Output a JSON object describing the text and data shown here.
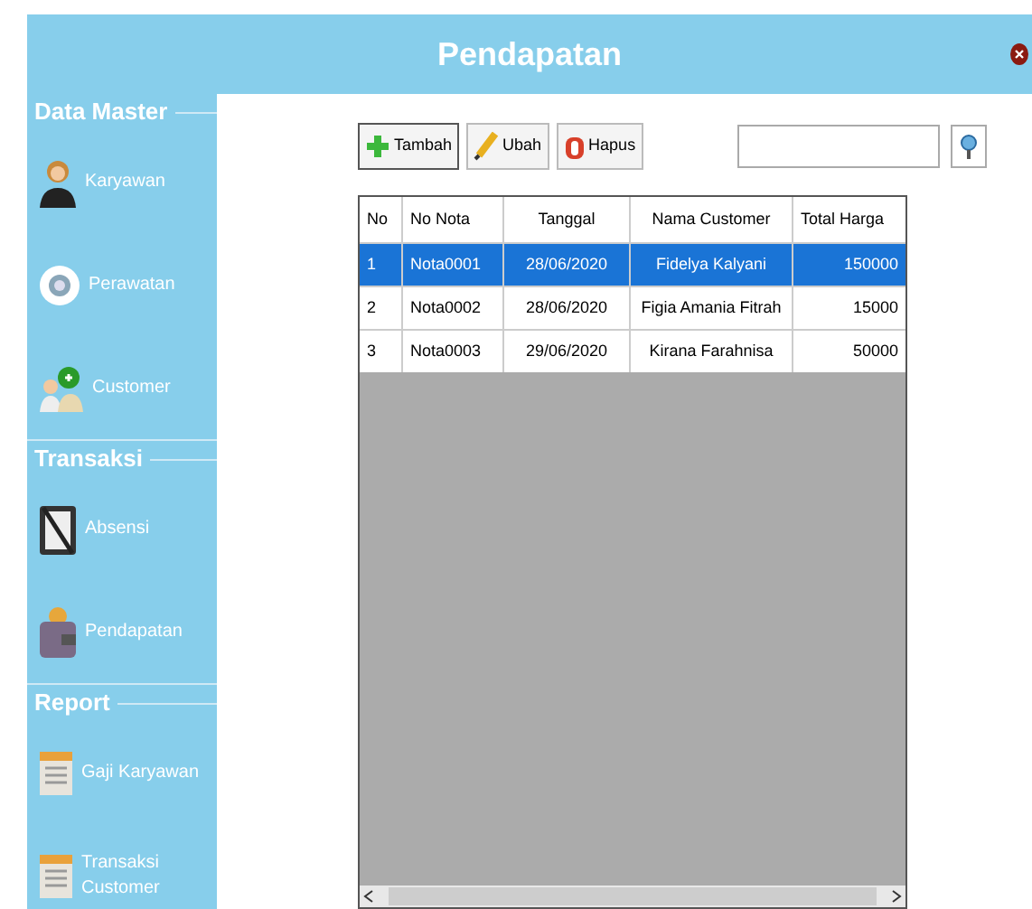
{
  "window": {
    "title": "Pendapatan"
  },
  "sidebar": {
    "sections": [
      {
        "title": "Data Master",
        "items": [
          {
            "label": "Karyawan",
            "kind": "person"
          },
          {
            "label": "Perawatan",
            "kind": "watch"
          },
          {
            "label": "Customer",
            "kind": "users"
          }
        ]
      },
      {
        "title": "Transaksi",
        "items": [
          {
            "label": "Absensi",
            "kind": "clipboard"
          },
          {
            "label": "Pendapatan",
            "kind": "wallet"
          }
        ]
      },
      {
        "title": "Report",
        "items": [
          {
            "label": "Gaji Karyawan",
            "kind": "document"
          },
          {
            "label": "Transaksi\nCustomer",
            "kind": "document"
          }
        ]
      }
    ]
  },
  "toolbar": {
    "buttons": [
      {
        "label": "Tambah",
        "kind": "add"
      },
      {
        "label": "Ubah",
        "kind": "edit"
      },
      {
        "label": "Hapus",
        "kind": "delete"
      }
    ]
  },
  "table": {
    "columns": [
      "No",
      "No Nota",
      "Tanggal",
      "Nama Customer",
      "Total Harga"
    ],
    "rows": [
      {
        "cells": [
          "1",
          "Nota0001",
          "28/06/2020",
          "Fidelya Kalyani",
          "150000"
        ],
        "selected": true
      },
      {
        "cells": [
          "2",
          "Nota0002",
          "28/06/2020",
          "Figia Amania Fitrah",
          "15000"
        ],
        "selected": false
      },
      {
        "cells": [
          "3",
          "Nota0003",
          "29/06/2020",
          "Kirana Farahnisa",
          "50000"
        ],
        "selected": false
      }
    ]
  }
}
